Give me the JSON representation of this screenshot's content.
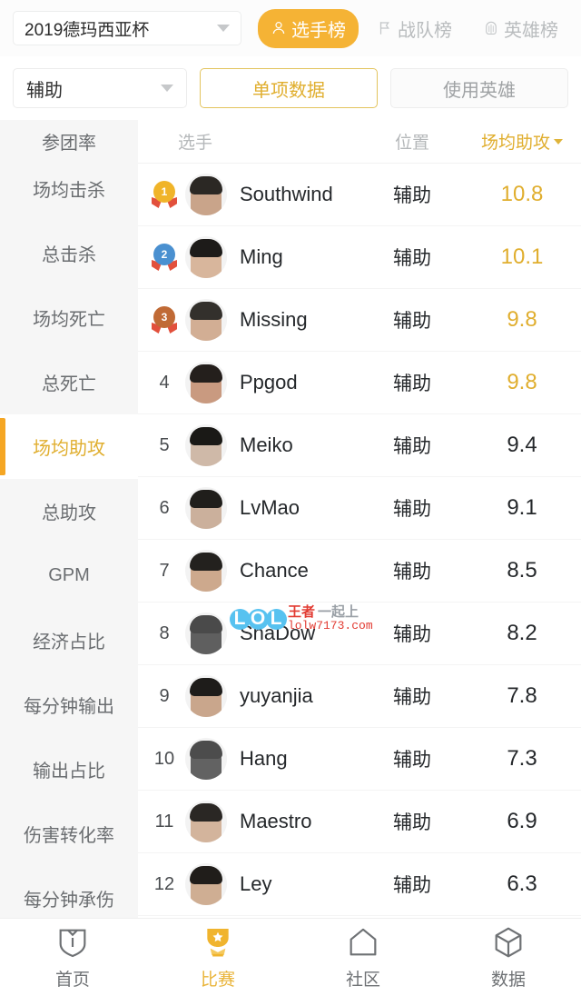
{
  "header": {
    "tournament": {
      "value": "2019德玛西亚杯",
      "caret_icon": "chevron-down-icon"
    },
    "rank_tabs": [
      {
        "label": "选手榜",
        "icon": "person-icon",
        "active": true
      },
      {
        "label": "战队榜",
        "icon": "flag-icon",
        "active": false
      },
      {
        "label": "英雄榜",
        "icon": "helmet-icon",
        "active": false
      }
    ]
  },
  "filter": {
    "position": {
      "value": "辅助",
      "caret_icon": "chevron-down-icon"
    },
    "segments": [
      {
        "label": "单项数据",
        "active": true
      },
      {
        "label": "使用英雄",
        "active": false
      }
    ]
  },
  "sidebar": {
    "items": [
      {
        "label": "参团率",
        "active": false,
        "clipped": true
      },
      {
        "label": "场均击杀",
        "active": false
      },
      {
        "label": "总击杀",
        "active": false
      },
      {
        "label": "场均死亡",
        "active": false
      },
      {
        "label": "总死亡",
        "active": false
      },
      {
        "label": "场均助攻",
        "active": true
      },
      {
        "label": "总助攻",
        "active": false
      },
      {
        "label": "GPM",
        "active": false
      },
      {
        "label": "经济占比",
        "active": false
      },
      {
        "label": "每分钟输出",
        "active": false
      },
      {
        "label": "输出占比",
        "active": false
      },
      {
        "label": "伤害转化率",
        "active": false
      },
      {
        "label": "每分钟承伤",
        "active": false
      }
    ]
  },
  "table": {
    "columns": {
      "player": "选手",
      "position": "位置",
      "value": "场均助攻"
    },
    "sort_icon": "caret-down-icon",
    "rows": [
      {
        "rank": "1",
        "medal": "gold",
        "name": "Southwind",
        "position": "辅助",
        "value": "10.8",
        "highlight": true,
        "hair": "#2b2824",
        "skin": "#c9a48a"
      },
      {
        "rank": "2",
        "medal": "silver",
        "name": "Ming",
        "position": "辅助",
        "value": "10.1",
        "highlight": true,
        "hair": "#1d1b19",
        "skin": "#d8b69c"
      },
      {
        "rank": "3",
        "medal": "bronze",
        "name": "Missing",
        "position": "辅助",
        "value": "9.8",
        "highlight": true,
        "hair": "#33302c",
        "skin": "#d2ae94"
      },
      {
        "rank": "4",
        "medal": "",
        "name": "Ppgod",
        "position": "辅助",
        "value": "9.8",
        "highlight": true,
        "hair": "#241f1c",
        "skin": "#c99a80"
      },
      {
        "rank": "5",
        "medal": "",
        "name": "Meiko",
        "position": "辅助",
        "value": "9.4",
        "highlight": false,
        "hair": "#1a1916",
        "skin": "#cfb9a8"
      },
      {
        "rank": "6",
        "medal": "",
        "name": "LvMao",
        "position": "辅助",
        "value": "9.1",
        "highlight": false,
        "hair": "#201e1b",
        "skin": "#cbb09c"
      },
      {
        "rank": "7",
        "medal": "",
        "name": "Chance",
        "position": "辅助",
        "value": "8.5",
        "highlight": false,
        "hair": "#23211e",
        "skin": "#cda98d"
      },
      {
        "rank": "8",
        "medal": "",
        "name": "ShaDow",
        "position": "辅助",
        "value": "8.2",
        "highlight": false,
        "hair": "#4a4a4a",
        "skin": "#5f5f5f"
      },
      {
        "rank": "9",
        "medal": "",
        "name": "yuyanjia",
        "position": "辅助",
        "value": "7.8",
        "highlight": false,
        "hair": "#1e1c1a",
        "skin": "#c9a68c"
      },
      {
        "rank": "10",
        "medal": "",
        "name": "Hang",
        "position": "辅助",
        "value": "7.3",
        "highlight": false,
        "hair": "#4c4c4c",
        "skin": "#626262"
      },
      {
        "rank": "11",
        "medal": "",
        "name": "Maestro",
        "position": "辅助",
        "value": "6.9",
        "highlight": false,
        "hair": "#2a2724",
        "skin": "#d3b49c"
      },
      {
        "rank": "12",
        "medal": "",
        "name": "Ley",
        "position": "辅助",
        "value": "6.3",
        "highlight": false,
        "hair": "#201d1a",
        "skin": "#cfae93"
      }
    ]
  },
  "watermark": {
    "logo": "LOL",
    "title_red": "王者",
    "title_gray": "一起上",
    "url": "lolw7173.com"
  },
  "bottom_nav": [
    {
      "label": "首页",
      "icon": "shield-icon",
      "active": false
    },
    {
      "label": "比赛",
      "icon": "trophy-icon",
      "active": true
    },
    {
      "label": "社区",
      "icon": "house-icon",
      "active": false
    },
    {
      "label": "数据",
      "icon": "cube-icon",
      "active": false
    }
  ],
  "colors": {
    "accent": "#f5b335",
    "gold_text": "#e0ae2e",
    "muted": "#b5b8ba"
  }
}
